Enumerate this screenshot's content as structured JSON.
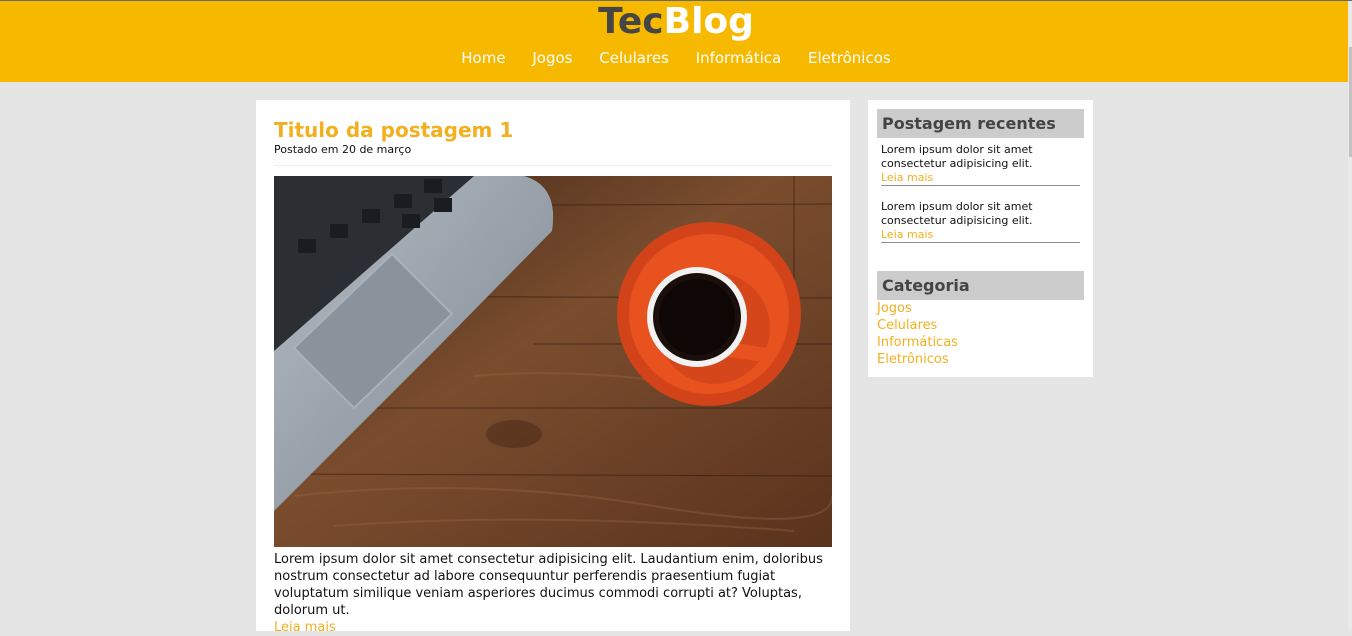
{
  "header": {
    "logo_part1": "Tec",
    "logo_part2": "Blog",
    "nav": [
      "Home",
      "Jogos",
      "Celulares",
      "Informática",
      "Eletrônicos"
    ]
  },
  "post": {
    "title": "Titulo da postagem 1",
    "meta": "Postado em 20 de março",
    "image_subject": "laptop-and-coffee-cup-on-wooden-desk",
    "text": "Lorem ipsum dolor sit amet consectetur adipisicing elit. Laudantium enim, doloribus nostrum consectetur ad labore consequuntur perferendis praesentium fugiat voluptatum similique veniam asperiores ducimus commodi corrupti at? Voluptas, dolorum ut.",
    "read_more": "Leia mais"
  },
  "sidebar": {
    "recent_heading": "Postagem recentes",
    "recent": [
      {
        "text": "Lorem ipsum dolor sit amet consectetur adipisicing elit.",
        "link": "Leia mais"
      },
      {
        "text": "Lorem ipsum dolor sit amet consectetur adipisicing elit.",
        "link": "Leia mais"
      }
    ],
    "category_heading": "Categoria",
    "categories": [
      "Jogos",
      "Celulares",
      "Informáticas",
      "Eletrônicos"
    ]
  },
  "colors": {
    "header_bg": "#f7b900",
    "accent": "#f2b020",
    "page_bg": "#e5e5e5",
    "heading_bg": "#cccccc"
  }
}
